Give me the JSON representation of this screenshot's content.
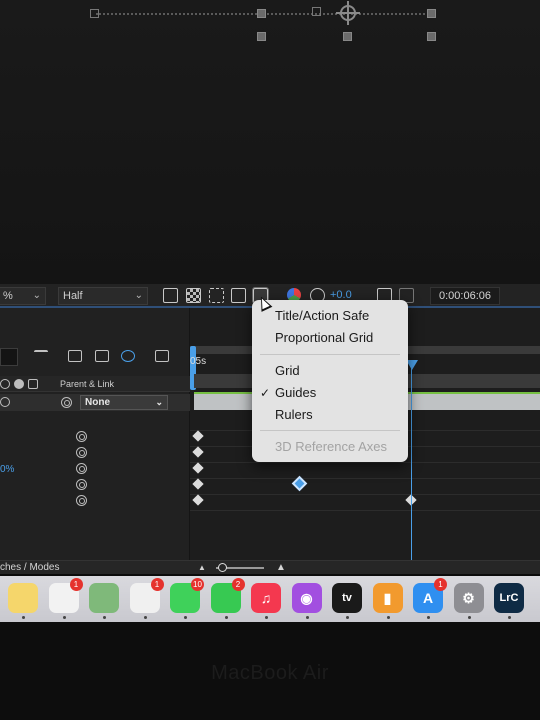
{
  "toolbar": {
    "magnification": "%",
    "resolution": "Half",
    "exposure": "+0.0",
    "timecode": "0:00:06:06"
  },
  "timeline": {
    "time_label": "05s",
    "parent_link_header": "Parent & Link",
    "parent_value": "None",
    "property_value": "0%"
  },
  "statusbar": {
    "toggle_label": "ches / Modes"
  },
  "view_options_menu": {
    "items": [
      {
        "label": "Title/Action Safe",
        "checked": false,
        "enabled": true
      },
      {
        "label": "Proportional Grid",
        "checked": false,
        "enabled": true
      },
      {
        "label": "Grid",
        "checked": false,
        "enabled": true
      },
      {
        "label": "Guides",
        "checked": true,
        "enabled": true
      },
      {
        "label": "Rulers",
        "checked": false,
        "enabled": true
      },
      {
        "label": "3D Reference Axes",
        "checked": false,
        "enabled": false
      }
    ],
    "checkmark": "✓"
  },
  "dock": {
    "apps": [
      {
        "name": "notes-app",
        "glyph": "",
        "color": "#f5d66b",
        "badge": ""
      },
      {
        "name": "reminders-app",
        "glyph": "",
        "color": "#f2f2f2",
        "badge": "1"
      },
      {
        "name": "maps-app",
        "glyph": "",
        "color": "#7fb97a",
        "badge": ""
      },
      {
        "name": "photos-app",
        "glyph": "",
        "color": "#f0f0f0",
        "badge": "1"
      },
      {
        "name": "messages-app",
        "glyph": "",
        "color": "#3fd15a",
        "badge": "10"
      },
      {
        "name": "facetime-app",
        "glyph": "",
        "color": "#37c952",
        "badge": "2"
      },
      {
        "name": "music-app",
        "glyph": "♫",
        "color": "#f4384f",
        "badge": ""
      },
      {
        "name": "podcasts-app",
        "glyph": "◉",
        "color": "#a24fe0",
        "badge": ""
      },
      {
        "name": "tv-app",
        "glyph": "tv",
        "color": "#1a1a1a",
        "badge": ""
      },
      {
        "name": "books-app",
        "glyph": "▮",
        "color": "#f29a2e",
        "badge": ""
      },
      {
        "name": "app-store-app",
        "glyph": "A",
        "color": "#2f8ff0",
        "badge": "1"
      },
      {
        "name": "system-settings-app",
        "glyph": "⚙",
        "color": "#8e8e93",
        "badge": ""
      },
      {
        "name": "lightroom-classic-app",
        "glyph": "LrC",
        "color": "#0f2b45",
        "badge": ""
      }
    ]
  },
  "device": {
    "brand_label": "MacBook Air"
  }
}
